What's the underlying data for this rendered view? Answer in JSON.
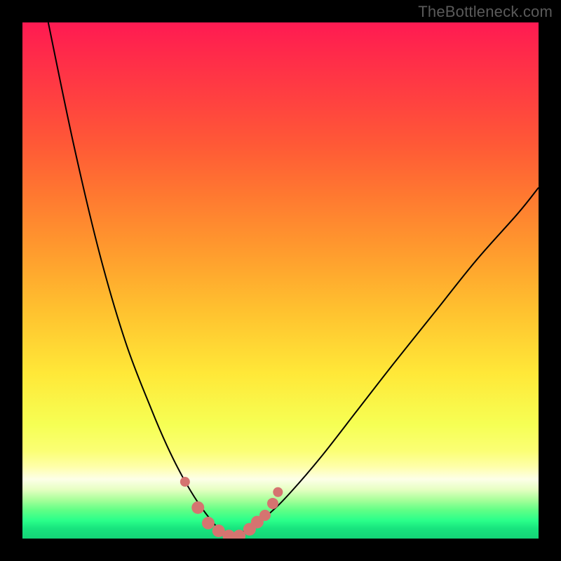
{
  "watermark": "TheBottleneck.com",
  "colors": {
    "frame": "#000000",
    "gradient_top": "#ff1a52",
    "gradient_mid": "#ffe838",
    "gradient_bottom": "#14d477",
    "curve": "#000000",
    "marker": "#d57470"
  },
  "chart_data": {
    "type": "line",
    "title": "",
    "xlabel": "",
    "ylabel": "",
    "xlim": [
      0,
      100
    ],
    "ylim": [
      0,
      100
    ],
    "grid": false,
    "legend": false,
    "description": "Bottleneck-style V-shaped curve over vertical red→yellow→green gradient. y plotted inversely: 0 = bottom (green), 100 = top (red). Minimum of the curve sits near x≈40 at y≈0–2. Pink circle markers cluster around the trough.",
    "series": [
      {
        "name": "left-branch",
        "x": [
          5,
          10,
          15,
          20,
          25,
          28,
          31,
          34,
          37,
          39,
          40
        ],
        "y": [
          100,
          76,
          55,
          38,
          25,
          18,
          12,
          7,
          3,
          1,
          0
        ]
      },
      {
        "name": "right-branch",
        "x": [
          40,
          44,
          48,
          52,
          58,
          65,
          72,
          80,
          88,
          96,
          100
        ],
        "y": [
          0,
          2,
          5,
          9,
          16,
          25,
          34,
          44,
          54,
          63,
          68
        ]
      }
    ],
    "markers": {
      "name": "trough-points",
      "x": [
        31.5,
        34,
        36,
        38,
        40,
        42,
        44,
        45.5,
        47,
        48.5,
        49.5
      ],
      "y": [
        11,
        6,
        3,
        1.5,
        0.5,
        0.5,
        1.8,
        3.2,
        4.5,
        6.8,
        9
      ],
      "r": [
        7,
        9,
        9,
        9,
        9,
        9,
        9,
        9,
        8,
        8,
        7
      ]
    }
  }
}
